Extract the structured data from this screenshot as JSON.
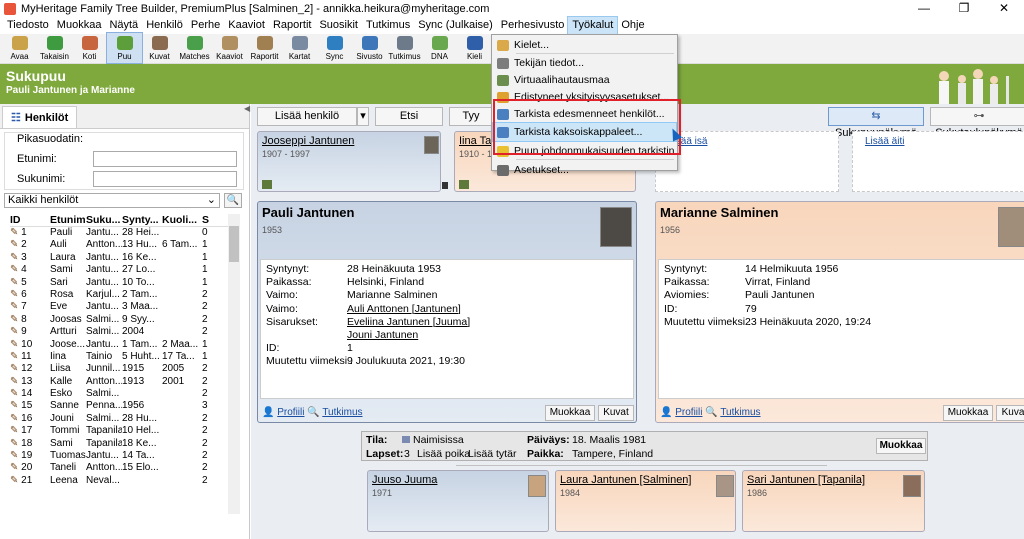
{
  "window": {
    "title": "MyHeritage Family Tree Builder, PremiumPlus [Salminen_2] - annikka.heikura@myheritage.com",
    "min": "—",
    "restore": "❐",
    "close": "✕"
  },
  "menubar": [
    "Tiedosto",
    "Muokkaa",
    "Näytä",
    "Henkilö",
    "Perhe",
    "Kaaviot",
    "Raportit",
    "Suosikit",
    "Tutkimus",
    "Sync (Julkaise)",
    "Perhesivusto",
    "Työkalut",
    "Ohje"
  ],
  "toolbar": [
    {
      "label": "Avaa",
      "color": "#c9a24a"
    },
    {
      "label": "Takaisin",
      "color": "#3f9b3f"
    },
    {
      "label": "Koti",
      "color": "#c7653f"
    },
    {
      "label": "Puu",
      "color": "#5c9e3a"
    },
    {
      "label": "Kuvat",
      "color": "#8a6b4f"
    },
    {
      "label": "Matches",
      "color": "#4aa04a"
    },
    {
      "label": "Kaaviot",
      "color": "#b09060"
    },
    {
      "label": "Raportit",
      "color": "#a08050"
    },
    {
      "label": "Kartat",
      "color": "#7a8aa0"
    },
    {
      "label": "Sync",
      "color": "#2e7fc2"
    },
    {
      "label": "Sivusto",
      "color": "#3d77b9"
    },
    {
      "label": "Tutkimus",
      "color": "#6c7a8a"
    },
    {
      "label": "DNA",
      "color": "#6aa84f"
    },
    {
      "label": "Kieli",
      "color": "#2e5fa8"
    }
  ],
  "header": {
    "title": "Sukupuu",
    "subtitle": "Pauli Jantunen ja Marianne"
  },
  "left": {
    "tab": "Henkilöt",
    "quickfilter": "Pikasuodatin:",
    "first_label": "Etunimi:",
    "last_label": "Sukunimi:",
    "select": "Kaikki henkilöt",
    "columns": [
      "ID",
      "Etunimi",
      "Suku...",
      "Synty...",
      "Kuoli...",
      "S"
    ],
    "rows": [
      [
        "1",
        "Pauli",
        "Jantu...",
        "28 Hei...",
        "",
        "0"
      ],
      [
        "2",
        "Auli",
        "Antton...",
        "13 Hu...",
        "6 Tam...",
        "1"
      ],
      [
        "3",
        "Laura",
        "Jantu...",
        "16 Ke...",
        "",
        "1"
      ],
      [
        "4",
        "Sami",
        "Jantu...",
        "27 Lo...",
        "",
        "1"
      ],
      [
        "5",
        "Sari",
        "Jantu...",
        "10 To...",
        "",
        "1"
      ],
      [
        "6",
        "Rosa",
        "Karjul...",
        "2 Tam...",
        "",
        "2"
      ],
      [
        "7",
        "Eve",
        "Jantu...",
        "3 Maa...",
        "",
        "2"
      ],
      [
        "8",
        "Joosas",
        "Salmi...",
        "9 Syy...",
        "",
        "2"
      ],
      [
        "9",
        "Artturi",
        "Salmi...",
        "2004",
        "",
        "2"
      ],
      [
        "10",
        "Joose...",
        "Jantu...",
        "1 Tam...",
        "2 Maa...",
        "1"
      ],
      [
        "11",
        "Iina",
        "Tainio",
        "5 Huht...",
        "17 Ta...",
        "1"
      ],
      [
        "12",
        "Liisa",
        "Junnil...",
        "1915",
        "2005",
        "2"
      ],
      [
        "13",
        "Kalle",
        "Antton...",
        "1913",
        "2001",
        "2"
      ],
      [
        "14",
        "Esko",
        "Salmi...",
        "",
        "",
        "2"
      ],
      [
        "15",
        "Sanne",
        "Penna...",
        "1956",
        "",
        "3"
      ],
      [
        "16",
        "Jouni",
        "Salmi...",
        "28 Hu...",
        "",
        "2"
      ],
      [
        "17",
        "Tommi",
        "Tapanila",
        "10 Hel...",
        "",
        "2"
      ],
      [
        "18",
        "Sami",
        "Tapanila",
        "18 Ke...",
        "",
        "2"
      ],
      [
        "19",
        "Tuomas",
        "Jantu...",
        "14 Ta...",
        "",
        "2"
      ],
      [
        "20",
        "Taneli",
        "Antton...",
        "15 Elo...",
        "",
        "2"
      ],
      [
        "21",
        "Leena",
        "Neval...",
        "",
        "",
        "2"
      ]
    ]
  },
  "main": {
    "add_person": "Lisää henkilö",
    "search": "Etsi",
    "type_btn": "Tyy",
    "view_family": "Sukupuunäkymä",
    "view_table": "Sukutaulunäkymä",
    "add_father": "Lisää isä",
    "add_mother": "Lisää äiti",
    "gp1": {
      "name": "Jooseppi Jantunen",
      "years": "1907 - 1997"
    },
    "gp2": {
      "name": "Iina Tain",
      "years": "1910 - 1"
    },
    "husband": {
      "name": "Pauli Jantunen",
      "year": "1953",
      "labels": [
        "Syntynyt:",
        "Paikassa:",
        "Vaimo:",
        "Vaimo:",
        "Sisarukset:",
        "",
        "ID:",
        "Muutettu viimeksi :"
      ],
      "values": [
        "28 Heinäkuuta 1953",
        "Helsinki, Finland",
        "Marianne Salminen",
        "Auli Anttonen [Jantunen]",
        "Eveliina Jantunen [Juuma]",
        "Jouni Jantunen",
        "1",
        "9 Joulukuuta 2021, 19:30"
      ]
    },
    "wife": {
      "name": "Marianne Salminen",
      "year": "1956",
      "labels": [
        "Syntynyt:",
        "Paikassa:",
        "Aviomies:",
        "ID:",
        "Muutettu viimeksi :"
      ],
      "values": [
        "14 Helmikuuta 1956",
        "Virrat, Finland",
        "Pauli Jantunen",
        "79",
        "23 Heinäkuuta 2020, 19:24"
      ]
    },
    "profile": "Profiili",
    "research": "Tutkimus",
    "edit": "Muokkaa",
    "photos": "Kuvat",
    "photos_cut": "Kuva",
    "marriage": {
      "status_label": "Tila:",
      "status": "Naimisissa",
      "date_label": "Päiväys:",
      "date": "18. Maalis 1981",
      "children_label": "Lapset:",
      "children": "3",
      "add_son": "Lisää poika",
      "add_daughter": "Lisää tytär",
      "place_label": "Paikka:",
      "place": "Tampere, Finland",
      "edit": "Muokkaa"
    },
    "children": [
      {
        "name": "Juuso Juuma",
        "year": "1971"
      },
      {
        "name": "Laura Jantunen [Salminen]",
        "year": "1984"
      },
      {
        "name": "Sari Jantunen [Tapanila]",
        "year": "1986"
      }
    ]
  },
  "menu": {
    "items": [
      "Kielet...",
      "Tekijän tiedot...",
      "Virtuaalihautausmaa",
      "Edistyneet yksityisyysasetukset...",
      "Tarkista edesmenneet henkilöt...",
      "Tarkista kaksoiskappaleet...",
      "Puun johdonmukaisuuden tarkistin",
      "Asetukset..."
    ],
    "icons": [
      "#d9a94a",
      "#7d7d7d",
      "#6b8e4e",
      "#e0a030",
      "#4a7fc0",
      "#4a7fc0",
      "#e8c030",
      "#6b6b6b"
    ]
  }
}
